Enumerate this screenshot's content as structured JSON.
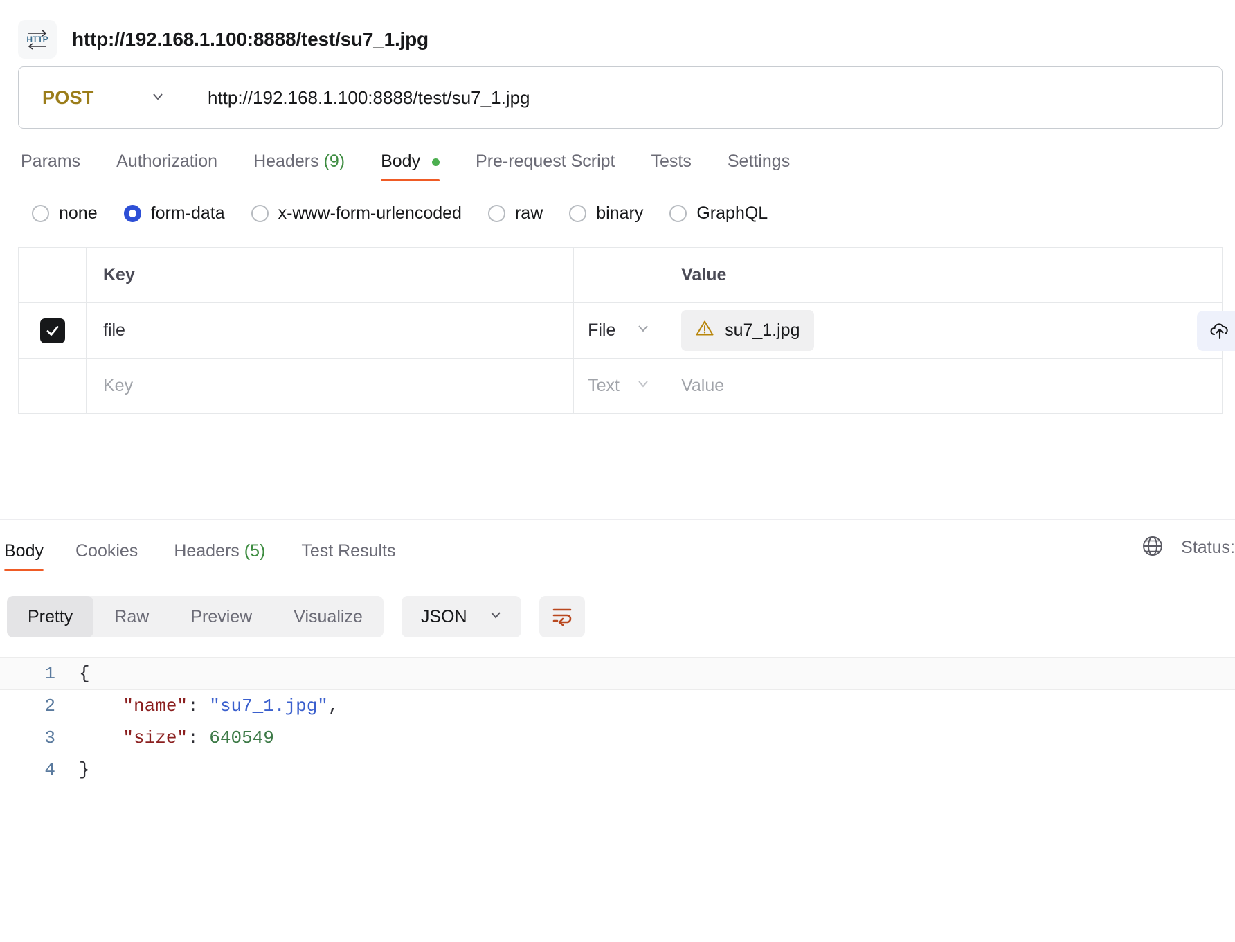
{
  "request": {
    "icon": "http-icon",
    "title": "http://192.168.1.100:8888/test/su7_1.jpg",
    "method": "POST",
    "url": "http://192.168.1.100:8888/test/su7_1.jpg",
    "tabs": [
      {
        "label": "Params",
        "active": false
      },
      {
        "label": "Authorization",
        "active": false
      },
      {
        "label": "Headers",
        "count": "(9)",
        "active": false
      },
      {
        "label": "Body",
        "dot": true,
        "active": true
      },
      {
        "label": "Pre-request Script",
        "active": false
      },
      {
        "label": "Tests",
        "active": false
      },
      {
        "label": "Settings",
        "active": false
      }
    ],
    "body_types": [
      {
        "label": "none",
        "selected": false
      },
      {
        "label": "form-data",
        "selected": true
      },
      {
        "label": "x-www-form-urlencoded",
        "selected": false
      },
      {
        "label": "raw",
        "selected": false
      },
      {
        "label": "binary",
        "selected": false
      },
      {
        "label": "GraphQL",
        "selected": false
      }
    ],
    "form_data": {
      "headers": {
        "key": "Key",
        "value": "Value"
      },
      "rows": [
        {
          "checked": true,
          "key": "file",
          "type": "File",
          "value": "su7_1.jpg",
          "value_icon": "warning-triangle-icon"
        }
      ],
      "placeholder_row": {
        "key": "Key",
        "type": "Text",
        "value": "Value"
      },
      "upload_icon": "upload-file-icon"
    }
  },
  "response": {
    "tabs": [
      {
        "label": "Body",
        "active": true
      },
      {
        "label": "Cookies",
        "active": false
      },
      {
        "label": "Headers",
        "count": "(5)",
        "active": false
      },
      {
        "label": "Test Results",
        "active": false
      }
    ],
    "globe_icon": "globe-icon",
    "status_label": "Status:",
    "viewer": {
      "modes": [
        {
          "label": "Pretty",
          "active": true
        },
        {
          "label": "Raw",
          "active": false
        },
        {
          "label": "Preview",
          "active": false
        },
        {
          "label": "Visualize",
          "active": false
        }
      ],
      "format": "JSON",
      "wrap_icon": "wrap-lines-icon"
    },
    "code": {
      "lines": [
        {
          "no": "1",
          "tokens": [
            {
              "t": "{",
              "c": "punc"
            }
          ]
        },
        {
          "no": "2",
          "tokens": [
            {
              "t": "    ",
              "c": "punc"
            },
            {
              "t": "\"name\"",
              "c": "key"
            },
            {
              "t": ": ",
              "c": "punc"
            },
            {
              "t": "\"su7_1.jpg\"",
              "c": "str"
            },
            {
              "t": ",",
              "c": "punc"
            }
          ]
        },
        {
          "no": "3",
          "tokens": [
            {
              "t": "    ",
              "c": "punc"
            },
            {
              "t": "\"size\"",
              "c": "key"
            },
            {
              "t": ": ",
              "c": "punc"
            },
            {
              "t": "640549",
              "c": "num"
            }
          ]
        },
        {
          "no": "4",
          "tokens": [
            {
              "t": "}",
              "c": "punc"
            }
          ]
        }
      ]
    }
  },
  "colors": {
    "accent_orange": "#ef5b25",
    "method_post": "#9b7d1a",
    "radio_selected": "#2d4fd6",
    "count_green": "#3d8c40",
    "warning_amber": "#b8860b"
  }
}
